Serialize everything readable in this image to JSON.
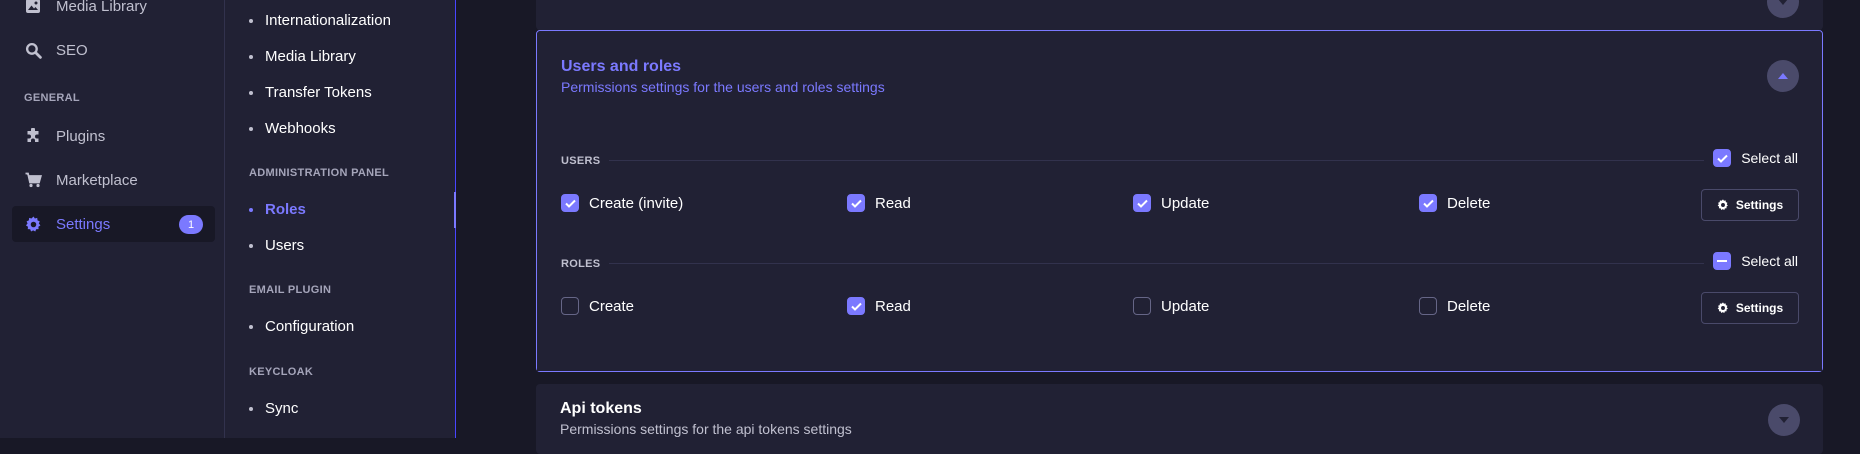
{
  "main_nav": {
    "items": [
      {
        "label": "Media Library",
        "icon": "image-icon"
      },
      {
        "label": "SEO",
        "icon": "search-icon"
      }
    ],
    "section_general": "GENERAL",
    "general_items": [
      {
        "label": "Plugins",
        "icon": "puzzle-icon"
      },
      {
        "label": "Marketplace",
        "icon": "cart-icon"
      },
      {
        "label": "Settings",
        "icon": "gear-icon",
        "badge": "1",
        "active": true
      }
    ]
  },
  "sub_nav": {
    "top_items": [
      "Internationalization",
      "Media Library",
      "Transfer Tokens",
      "Webhooks"
    ],
    "admin_section": "ADMINISTRATION PANEL",
    "admin_items": [
      "Roles",
      "Users"
    ],
    "email_section": "EMAIL PLUGIN",
    "email_items": [
      "Configuration"
    ],
    "keycloak_section": "KEYCLOAK",
    "keycloak_items": [
      "Sync"
    ]
  },
  "users_roles": {
    "title": "Users and roles",
    "subtitle": "Permissions settings for the users and roles settings",
    "users": {
      "label": "USERS",
      "select_all": "Select all",
      "select_all_state": "checked",
      "permissions": [
        {
          "label": "Create (invite)",
          "checked": true
        },
        {
          "label": "Read",
          "checked": true
        },
        {
          "label": "Update",
          "checked": true
        },
        {
          "label": "Delete",
          "checked": true
        }
      ],
      "settings_label": "Settings"
    },
    "roles": {
      "label": "ROLES",
      "select_all": "Select all",
      "select_all_state": "indeterminate",
      "permissions": [
        {
          "label": "Create",
          "checked": false
        },
        {
          "label": "Read",
          "checked": true
        },
        {
          "label": "Update",
          "checked": false
        },
        {
          "label": "Delete",
          "checked": false
        }
      ],
      "settings_label": "Settings"
    }
  },
  "api_tokens": {
    "title": "Api tokens",
    "subtitle": "Permissions settings for the api tokens settings"
  },
  "colors": {
    "accent": "#7b79ff",
    "background": "#181826",
    "panel": "#212134"
  }
}
